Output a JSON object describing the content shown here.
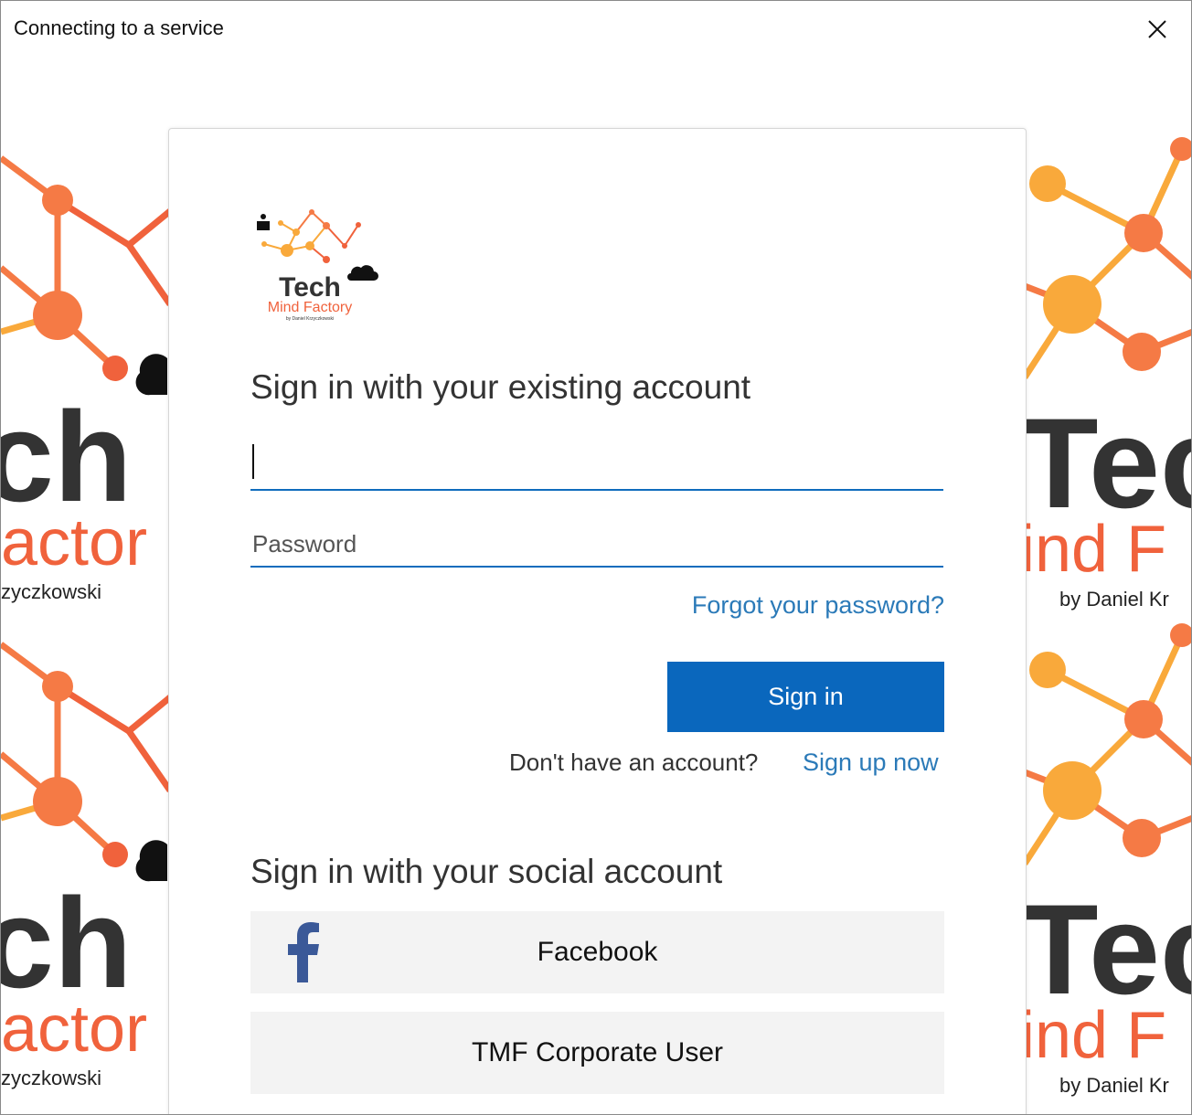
{
  "window": {
    "title": "Connecting to a service"
  },
  "background": {
    "brand_word": "Tech",
    "brand_sub": "Mind Factory",
    "brand_by": "by Daniel Krzyczkowski",
    "left_word": "ch",
    "left_sub": "actor",
    "left_by": "zyczkowski",
    "right_word": "Tec",
    "right_sub": "ind F",
    "right_by": "by Daniel Kr"
  },
  "logo": {
    "word": "Tech",
    "sub": "Mind Factory",
    "by": "by Daniel Krzyczkowski"
  },
  "form": {
    "heading": "Sign in with your existing account",
    "username_value": "",
    "password_placeholder": "Password",
    "forgot_link": "Forgot your password?",
    "sign_in_button": "Sign in",
    "no_account_text": "Don't have an account?",
    "sign_up_link": "Sign up now"
  },
  "social": {
    "heading": "Sign in with your social account",
    "providers": [
      {
        "label": "Facebook",
        "icon": "facebook-icon"
      },
      {
        "label": "TMF Corporate User"
      }
    ]
  },
  "colors": {
    "accent": "#0a67bd",
    "link": "#2b7ab8",
    "brand_orange": "#f0623c",
    "brand_yellow": "#f9a93b",
    "brand_dark": "#333333"
  }
}
